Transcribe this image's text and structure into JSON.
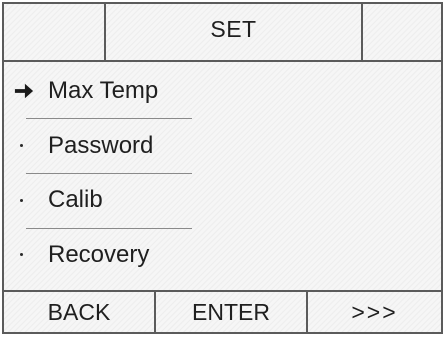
{
  "header": {
    "title": "SET"
  },
  "menu": {
    "items": [
      {
        "label": "Max Temp",
        "selected": true
      },
      {
        "label": "Password",
        "selected": false
      },
      {
        "label": "Calib",
        "selected": false
      },
      {
        "label": "Recovery",
        "selected": false
      }
    ],
    "selection_icon": "right-arrow-icon"
  },
  "footer": {
    "back_label": "BACK",
    "enter_label": "ENTER",
    "next_label": ">>>"
  },
  "colors": {
    "border": "#5b5b5b",
    "text": "#1f1f1f",
    "background": "#f3f3f3"
  }
}
